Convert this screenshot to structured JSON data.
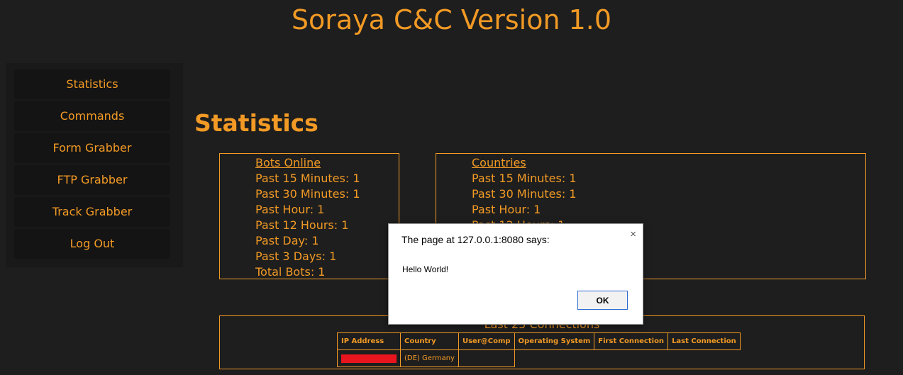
{
  "header": {
    "title": "Soraya C&C Version 1.0"
  },
  "sidebar": {
    "items": [
      {
        "label": "Statistics"
      },
      {
        "label": "Commands"
      },
      {
        "label": "Form Grabber"
      },
      {
        "label": "FTP Grabber"
      },
      {
        "label": "Track Grabber"
      },
      {
        "label": "Log Out"
      }
    ]
  },
  "main": {
    "heading": "Statistics",
    "bots_online": {
      "title": "Bots Online",
      "rows": [
        "Past 15 Minutes: 1",
        "Past 30 Minutes: 1",
        "Past Hour: 1",
        "Past 12 Hours: 1",
        "Past Day: 1",
        "Past 3 Days: 1",
        "Total Bots: 1"
      ]
    },
    "countries": {
      "title": "Countries",
      "rows": [
        "Past 15 Minutes: 1",
        "Past 30 Minutes: 1",
        "Past Hour: 1",
        "Past 12 Hours: 1"
      ]
    },
    "connections": {
      "title": "Last 25 Connections",
      "columns": [
        "IP Address",
        "Country",
        "User@Comp",
        "Operating System",
        "First Connection",
        "Last Connection"
      ],
      "rows": [
        {
          "country": "(DE) Germany"
        }
      ]
    }
  },
  "dialog": {
    "title": "The page at 127.0.0.1:8080 says:",
    "close_glyph": "×",
    "message": "Hello World!",
    "ok_label": "OK"
  },
  "colors": {
    "accent": "#f29a25",
    "background": "#1e1e1e",
    "sidebar": "#191919",
    "redaction": "#e8141e"
  }
}
